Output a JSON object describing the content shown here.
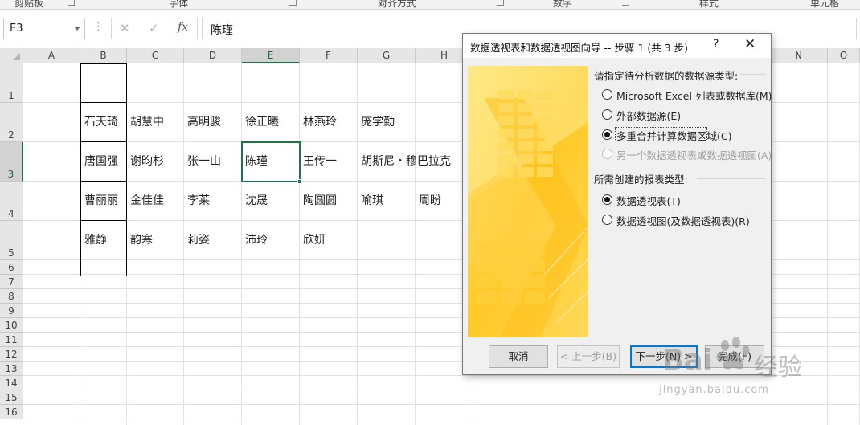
{
  "ribbon": {
    "groups": [
      "剪贴板",
      "字体",
      "对齐方式",
      "数字",
      "样式",
      "单元格"
    ]
  },
  "formula_bar": {
    "name_box": "E3",
    "cancel_icon": "✕",
    "enter_icon": "✓",
    "fx_label": "fx",
    "value": "陈瑾"
  },
  "grid": {
    "columns": [
      "A",
      "B",
      "C",
      "D",
      "E",
      "F",
      "G",
      "H",
      "N",
      "O"
    ],
    "rows": [
      "1",
      "2",
      "3",
      "4",
      "5",
      "6",
      "7",
      "8",
      "9",
      "10",
      "11",
      "12",
      "13",
      "14",
      "15",
      "16"
    ],
    "active_cell": "E3",
    "cells": {
      "B2": "石天琦",
      "C2": "胡慧中",
      "D2": "高明骏",
      "E2": "徐正曦",
      "F2": "林燕玲",
      "G2": "庞学勤",
      "B3": "唐国强",
      "C3": "谢昀杉",
      "D3": "张一山",
      "E3": "陈瑾",
      "F3": "王传一",
      "G3": "胡斯尼・穆巴拉克",
      "B4": "曹丽丽",
      "C4": "金佳佳",
      "D4": "李莱",
      "E4": "沈晟",
      "F4": "陶圆圆",
      "G4": "喻琪",
      "H4": "周盼",
      "B5": "雅静",
      "C5": "韵寒",
      "D5": "莉姿",
      "E5": "沛玲",
      "F5": "欣妍"
    }
  },
  "dialog": {
    "title": "数据透视表和数据透视图向导 -- 步骤 1 (共 3 步)",
    "help": "?",
    "close": "✕",
    "source_prompt": "请指定待分析数据的数据源类型:",
    "source_options": [
      {
        "label": "Microsoft Excel 列表或数据库(M)",
        "checked": false,
        "disabled": false
      },
      {
        "label": "外部数据源(E)",
        "checked": false,
        "disabled": false
      },
      {
        "label": "多重合并计算数据区域(C)",
        "checked": true,
        "disabled": false
      },
      {
        "label": "另一个数据透视表或数据透视图(A)",
        "checked": false,
        "disabled": true
      }
    ],
    "report_prompt": "所需创建的报表类型:",
    "report_options": [
      {
        "label": "数据透视表(T)",
        "checked": true
      },
      {
        "label": "数据透视图(及数据透视表)(R)",
        "checked": false
      }
    ],
    "buttons": {
      "cancel": "取消",
      "back": "< 上一步(B)",
      "next": "下一步(N) >",
      "finish": "完成(F)"
    }
  },
  "watermark": {
    "brand": "Bai",
    "brand_suffix": "经验",
    "url": "jingyan.baidu.com"
  },
  "colors": {
    "excel_green": "#217346",
    "dialog_bg": "#f0f0f0",
    "accent_blue": "#0078d7",
    "arrow_red": "#e8281e",
    "wizard_yellow": "#ffd64a"
  }
}
